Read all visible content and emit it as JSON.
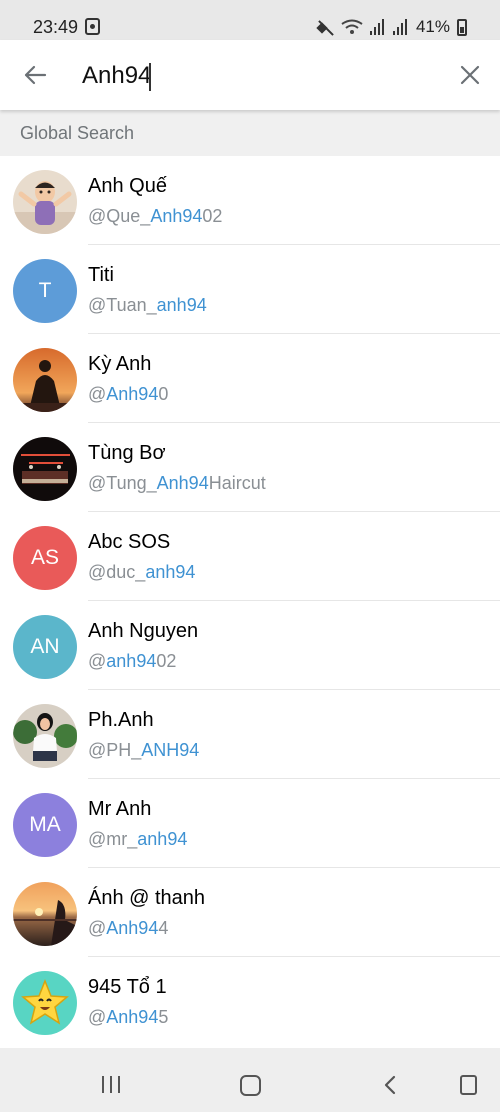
{
  "status_bar": {
    "time": "23:49",
    "battery": "41%"
  },
  "search": {
    "query": "Anh94",
    "back_icon": "arrow-left-icon",
    "clear_icon": "close-icon"
  },
  "section": {
    "title": "Global Search"
  },
  "results": [
    {
      "name": "Anh Quế",
      "username_prefix": "@Que_",
      "username_match": "Anh94",
      "username_suffix": "02",
      "avatar_type": "photo-child"
    },
    {
      "name": "Titi",
      "username_prefix": "@Tuan_",
      "username_match": "anh94",
      "username_suffix": "",
      "avatar_type": "initials",
      "initials": "T",
      "avatar_color": "#5d9cd8"
    },
    {
      "name": "Kỳ Anh",
      "username_prefix": "@",
      "username_match": "Anh94",
      "username_suffix": "0",
      "avatar_type": "photo-sunset-silhouette"
    },
    {
      "name": "Tùng Bơ",
      "username_prefix": "@Tung_",
      "username_match": "Anh94",
      "username_suffix": "Haircut",
      "avatar_type": "photo-dark-shop"
    },
    {
      "name": "Abc SOS",
      "username_prefix": "@duc_",
      "username_match": "anh94",
      "username_suffix": "",
      "avatar_type": "initials",
      "initials": "AS",
      "avatar_color": "#e95a59"
    },
    {
      "name": "Anh Nguyen",
      "username_prefix": "@",
      "username_match": "anh94",
      "username_suffix": "02",
      "avatar_type": "initials",
      "initials": "AN",
      "avatar_color": "#5bb6cb"
    },
    {
      "name": "Ph.Anh",
      "username_prefix": "@PH_",
      "username_match": "ANH94",
      "username_suffix": "",
      "avatar_type": "photo-woman-plants"
    },
    {
      "name": "Mr Anh",
      "username_prefix": "@mr_",
      "username_match": "anh94",
      "username_suffix": "",
      "avatar_type": "initials",
      "initials": "MA",
      "avatar_color": "#8c80dd"
    },
    {
      "name": "Ánh @ thanh",
      "username_prefix": "@",
      "username_match": "Anh94",
      "username_suffix": "4",
      "avatar_type": "photo-sunset-beach"
    },
    {
      "name": "945 Tổ 1",
      "username_prefix": "@",
      "username_match": "Anh94",
      "username_suffix": "5",
      "avatar_type": "emoji-star"
    }
  ],
  "navigation": {
    "recents_icon": "recents-icon",
    "home_icon": "home-icon",
    "back_icon": "back-icon",
    "rotate_icon": "rotate-icon"
  },
  "colors": {
    "link_blue": "#3f92d2",
    "muted_gray": "#8a8f94",
    "section_bg": "#f0f0f0"
  }
}
